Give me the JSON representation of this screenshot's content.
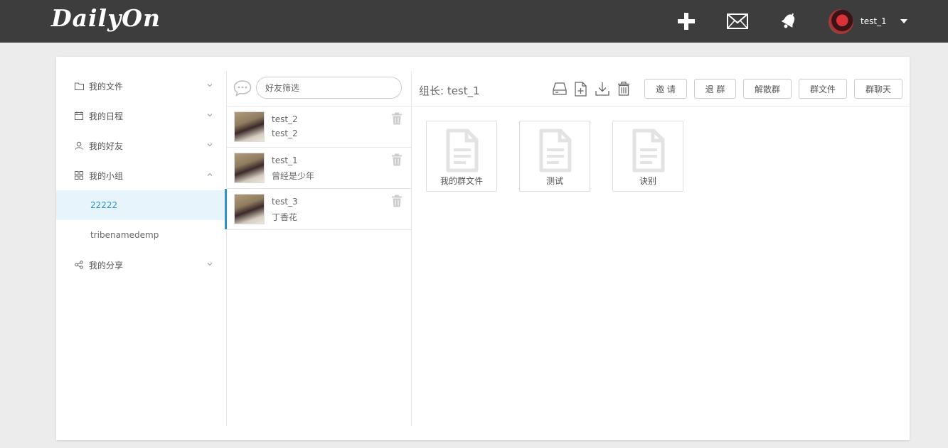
{
  "header": {
    "logo": "DailyOn",
    "icons": [
      "plus-icon",
      "mail-icon",
      "bell-icon"
    ],
    "user": {
      "name": "test_1"
    }
  },
  "sidebar": {
    "items": [
      {
        "label": "我的文件",
        "icon": "folder-icon"
      },
      {
        "label": "我的日程",
        "icon": "calendar-icon"
      },
      {
        "label": "我的好友",
        "icon": "person-icon"
      },
      {
        "label": "我的小组",
        "icon": "group-icon",
        "expanded": true,
        "children": [
          {
            "label": "22222",
            "active": true
          },
          {
            "label": "tribenamedemp"
          }
        ]
      },
      {
        "label": "我的分享",
        "icon": "share-icon"
      }
    ]
  },
  "friends": {
    "search_placeholder": "好友筛选",
    "items": [
      {
        "name": "test_2",
        "message": "test_2"
      },
      {
        "name": "test_1",
        "message": "曾经是少年"
      },
      {
        "name": "test_3",
        "message": "丁香花",
        "active": true
      }
    ]
  },
  "group": {
    "leader_label": "组长: test_1",
    "toolbar_icons": [
      "drive-icon",
      "new-file-icon",
      "download-icon",
      "delete-icon"
    ],
    "buttons": {
      "invite": "邀 请",
      "quit": "退 群",
      "dissolve": "解散群",
      "files": "群文件",
      "chat": "群聊天"
    },
    "files": [
      {
        "name": "我的群文件"
      },
      {
        "name": "测试"
      },
      {
        "name": "诀别"
      }
    ]
  },
  "colors": {
    "topbar": "#3d3d3d",
    "accent": "#2a93d1",
    "active_bg": "#e8f4fb",
    "page_bg": "#ececec"
  }
}
